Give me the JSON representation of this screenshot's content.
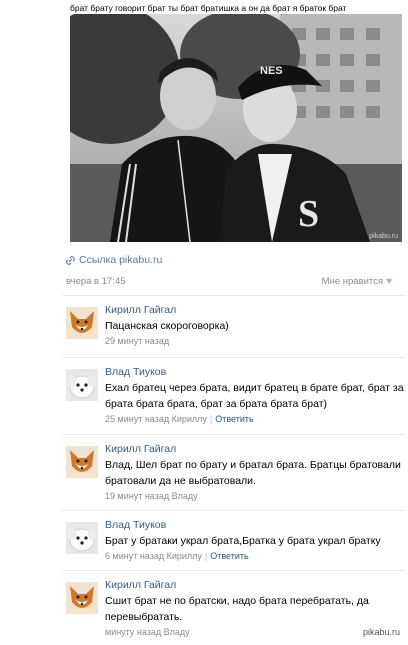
{
  "post": {
    "caption": "брат брату говорит брат ты брат братишка а он да брат я браток брат",
    "photo_watermark": "pikabu.ru",
    "link_label": "Ссылка pikabu.ru",
    "timestamp": "вчера в 17:45",
    "like_label": "Мне нравится"
  },
  "comments": [
    {
      "author": "Кирилл Гайгал",
      "text": "Пацанская скороговорка)",
      "time": "29 минут назад",
      "reply_label": "",
      "avatar": "fox-avatar"
    },
    {
      "author": "Влад Тиуков",
      "text": "Ехал братец через брата, видит братец в брате брат, брат за брата брата брата, брат за брата брата брат)",
      "time": "25 минут назад Кириллу",
      "reply_label": "Ответить",
      "avatar": "white-dog-avatar"
    },
    {
      "author": "Кирилл Гайгал",
      "text": "Влад, Шел брат по брату и братал брата. Братцы братовали братовали да не выбратовали.",
      "time": "19 минут назад Владу",
      "reply_label": "",
      "avatar": "fox-avatar"
    },
    {
      "author": "Влад Тиуков",
      "text": "Брат у братаки украл брата,Братка у брата украл братку",
      "time": "6 минут назад Кириллу",
      "reply_label": "Ответить",
      "avatar": "white-dog-avatar"
    },
    {
      "author": "Кирилл Гайгал",
      "text": "Сшит брат не по братски, надо брата перебратать, да перевыбратать.",
      "time": "минуту назад Владу",
      "reply_label": "",
      "avatar": "fox-avatar"
    }
  ],
  "footer": {
    "watermark": "pikabu.ru"
  },
  "colors": {
    "link": "#5b7a9e",
    "author": "#3b5c80",
    "meta": "#8a8a8a",
    "reply": "#2b587a"
  }
}
